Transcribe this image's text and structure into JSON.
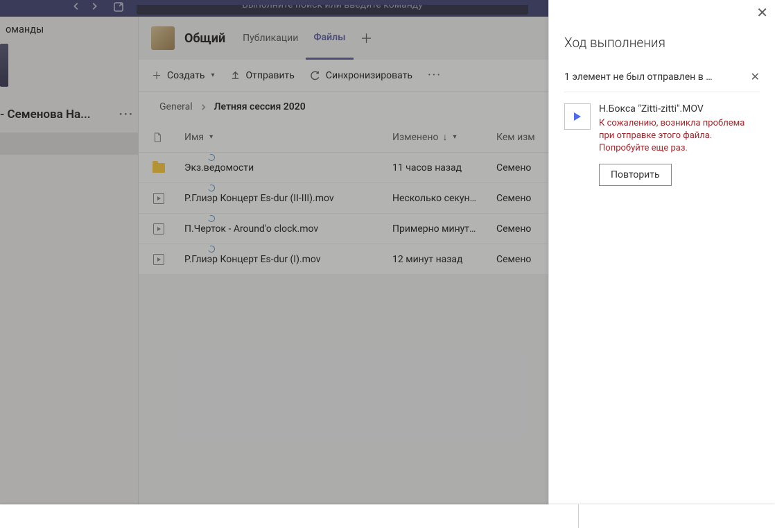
{
  "search": {
    "placeholder": "Выполните поиск или введите команду"
  },
  "sidebar": {
    "section_label": "оманды",
    "team_name": " - Семенова На...",
    "channel_selected": ""
  },
  "header": {
    "channel": "Общий",
    "tabs": [
      {
        "label": "Публикации"
      },
      {
        "label": "Файлы"
      }
    ],
    "active_tab": 1
  },
  "toolbar": {
    "create": "Создать",
    "upload": "Отправить",
    "sync": "Синхронизировать"
  },
  "breadcrumb": {
    "root": "General",
    "current": "Летняя сессия 2020"
  },
  "columns": {
    "name": "Имя",
    "modified": "Изменено",
    "modified_by": "Кем изм"
  },
  "files": [
    {
      "type": "folder",
      "name": "Экз.ведомости",
      "modified": "11 часов назад",
      "modified_by": "Семено"
    },
    {
      "type": "video",
      "name": "Р.Глиэр Концерт Es-dur (II-III).mov",
      "modified": "Несколько секун…",
      "modified_by": "Семено"
    },
    {
      "type": "video",
      "name": "П.Черток - Around'o clock.mov",
      "modified": "Примерно минут…",
      "modified_by": "Семено"
    },
    {
      "type": "video",
      "name": "Р.Глиэр Концерт Es-dur (I).mov",
      "modified": "12 минут назад",
      "modified_by": "Семено"
    }
  ],
  "panel": {
    "title": "Ход выполнения",
    "summary": "1 элемент не был отправлен в …",
    "item": {
      "name": "Н.Бокса \"Zitti-zitti\".MOV",
      "error": "К сожалению, возникла проблема при отправке этого файла. Попробуйте еще раз.",
      "retry": "Повторить"
    }
  }
}
